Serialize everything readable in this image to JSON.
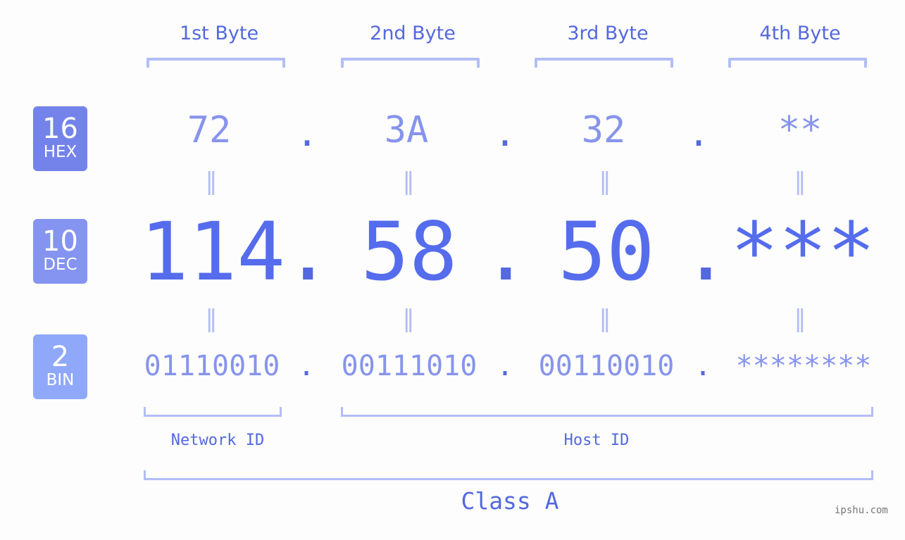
{
  "bytes": {
    "labels": [
      "1st Byte",
      "2nd Byte",
      "3rd Byte",
      "4th Byte"
    ]
  },
  "bases": {
    "hex": {
      "number": "16",
      "name": "HEX",
      "color": "#7383ea"
    },
    "dec": {
      "number": "10",
      "name": "DEC",
      "color": "#8494f0"
    },
    "bin": {
      "number": "2",
      "name": "BIN",
      "color": "#8fa8f9"
    }
  },
  "ip": {
    "separator": ".",
    "equals": "=",
    "hex": [
      "72",
      "3A",
      "32",
      "**"
    ],
    "dec": [
      "114",
      "58",
      "50",
      "***"
    ],
    "bin": [
      "01110010",
      "00111010",
      "00110010",
      "********"
    ]
  },
  "segments": {
    "network_id": "Network ID",
    "host_id": "Host ID",
    "class": "Class A"
  },
  "watermark": "ipshu.com",
  "colors": {
    "accent": "#556ced",
    "muted_value": "#8794ec",
    "bracket": "#b3bdf6",
    "background": "#fcfdfc"
  }
}
